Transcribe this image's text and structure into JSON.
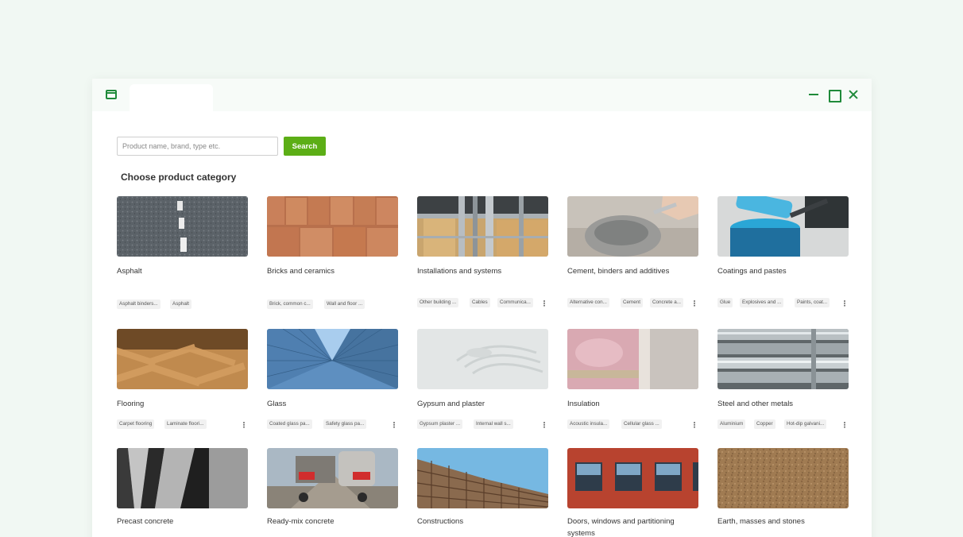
{
  "search": {
    "placeholder": "Product name, brand, type etc.",
    "button_label": "Search"
  },
  "section_title": "Choose product category",
  "more_icon": "more-vertical-icon",
  "colors": {
    "background": "#f1f8f3",
    "accent": "#1f8a3a",
    "search_button": "#5cae16"
  },
  "categories": [
    {
      "name": "Asphalt",
      "tags": [
        "Asphalt binders...",
        "Asphalt"
      ],
      "has_more": false
    },
    {
      "name": "Bricks and ceramics",
      "tags": [
        "Brick, common c...",
        "Wall and floor ..."
      ],
      "has_more": false
    },
    {
      "name": "Installations and systems",
      "tags": [
        "Other building ...",
        "Cables",
        "Communica..."
      ],
      "has_more": true
    },
    {
      "name": "Cement, binders and additives",
      "tags": [
        "Alternative con...",
        "Cement",
        "Concrete a..."
      ],
      "has_more": true
    },
    {
      "name": "Coatings and pastes",
      "tags": [
        "Glue",
        "Explosives and ...",
        "Paints, coat..."
      ],
      "has_more": true
    },
    {
      "name": "Flooring",
      "tags": [
        "Carpet flooring",
        "Laminate floori..."
      ],
      "has_more": true
    },
    {
      "name": "Glass",
      "tags": [
        "Coated glass pa...",
        "Safety glass pa..."
      ],
      "has_more": true
    },
    {
      "name": "Gypsum and plaster",
      "tags": [
        "Gypsum plaster ...",
        "Internal wall s..."
      ],
      "has_more": true
    },
    {
      "name": "Insulation",
      "tags": [
        "Acoustic insula...",
        "Cellular glass ..."
      ],
      "has_more": true
    },
    {
      "name": "Steel and other metals",
      "tags": [
        "Aluminium",
        "Copper",
        "Hot-dip galvani..."
      ],
      "has_more": true
    },
    {
      "name": "Precast concrete",
      "tags": [],
      "has_more": false
    },
    {
      "name": "Ready-mix concrete",
      "tags": [],
      "has_more": false
    },
    {
      "name": "Constructions",
      "tags": [],
      "has_more": false
    },
    {
      "name": "Doors, windows and partitioning systems",
      "tags": [],
      "has_more": false
    },
    {
      "name": "Earth, masses and stones",
      "tags": [],
      "has_more": false
    }
  ]
}
